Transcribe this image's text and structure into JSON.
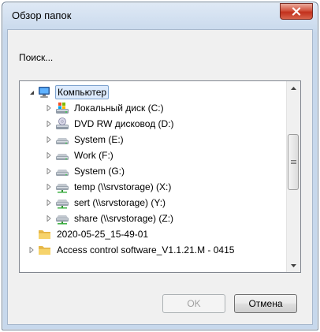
{
  "window": {
    "title": "Обзор папок",
    "close_symbol": "x"
  },
  "search_label": "Поиск...",
  "tree": {
    "items": [
      {
        "label": "Компьютер",
        "icon": "computer-icon",
        "level": 0,
        "expander": "expanded",
        "selected": true
      },
      {
        "label": "Локальный диск (C:)",
        "icon": "local-disk-icon",
        "level": 1,
        "expander": "collapsed"
      },
      {
        "label": "DVD RW дисковод (D:)",
        "icon": "dvd-drive-icon",
        "level": 1,
        "expander": "collapsed"
      },
      {
        "label": "System (E:)",
        "icon": "drive-icon",
        "level": 1,
        "expander": "collapsed"
      },
      {
        "label": "Work (F:)",
        "icon": "drive-icon",
        "level": 1,
        "expander": "collapsed"
      },
      {
        "label": "System (G:)",
        "icon": "drive-icon",
        "level": 1,
        "expander": "collapsed"
      },
      {
        "label": "temp (\\\\srvstorage) (X:)",
        "icon": "network-drive-icon",
        "level": 1,
        "expander": "collapsed"
      },
      {
        "label": "sert (\\\\srvstorage) (Y:)",
        "icon": "network-drive-icon",
        "level": 1,
        "expander": "collapsed"
      },
      {
        "label": "share (\\\\srvstorage) (Z:)",
        "icon": "network-drive-icon",
        "level": 1,
        "expander": "collapsed"
      },
      {
        "label": "2020-05-25_15-49-01",
        "icon": "folder-icon",
        "level": 0,
        "expander": "none"
      },
      {
        "label": "Access control software_V1.1.21.M - 0415",
        "icon": "folder-icon",
        "level": 0,
        "expander": "collapsed"
      }
    ]
  },
  "buttons": {
    "ok": "OK",
    "cancel": "Отмена"
  },
  "colors": {
    "selection_bg": "#dceafc",
    "selection_border": "#7da2ce",
    "close_red": "#c2301c"
  }
}
